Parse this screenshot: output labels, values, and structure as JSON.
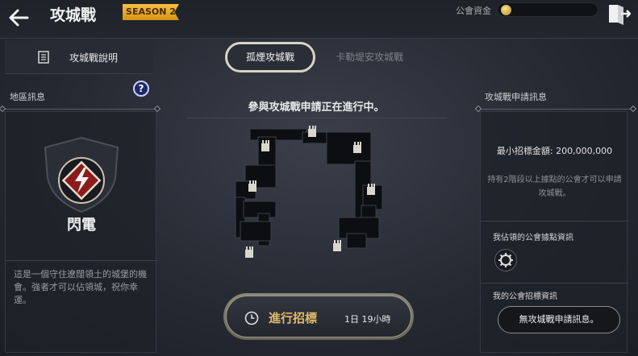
{
  "header": {
    "title": "攻城戰",
    "season_badge": "SEASON 2",
    "guild_funds_label": "公會資金",
    "back_icon": "back-arrow-icon",
    "exit_icon": "exit-door-icon"
  },
  "left_tab": {
    "label": "攻城戰說明",
    "icon": "document-icon"
  },
  "center_tabs": [
    {
      "label": "孤煙攻城戰",
      "active": true
    },
    {
      "label": "卡勒堤安攻城戰",
      "active": false
    }
  ],
  "region": {
    "section_label": "地區訊息",
    "help_label": "?",
    "name": "閃電",
    "emblem_icon": "lightning-emblem-icon",
    "description": "這是一個守住遼闊領土的城堡的機會。強者才可以佔領城，祝你幸運。"
  },
  "center": {
    "status": "參與攻城戰申請正在進行中。",
    "bid_button_label": "進行招標",
    "bid_time": "1日 19小時",
    "bid_icon": "clock-icon"
  },
  "application": {
    "section_label": "攻城戰申請訊息",
    "min_bid": "最小招標金額: 200,000,000",
    "requirement": "持有2階段以上據點的公會才可以申請攻城戰。",
    "occupied_label": "我佔領的公會據點資訊",
    "occupied_icon": "gear-icon",
    "guild_bid_label": "我的公會招標資訊",
    "no_application": "無攻城戰申請訊息。"
  },
  "colors": {
    "accent_gold": "#e2bb6a",
    "season_badge": "#f5c043",
    "help_badge": "#1e2a66",
    "panel_bg": "#1e2128"
  }
}
